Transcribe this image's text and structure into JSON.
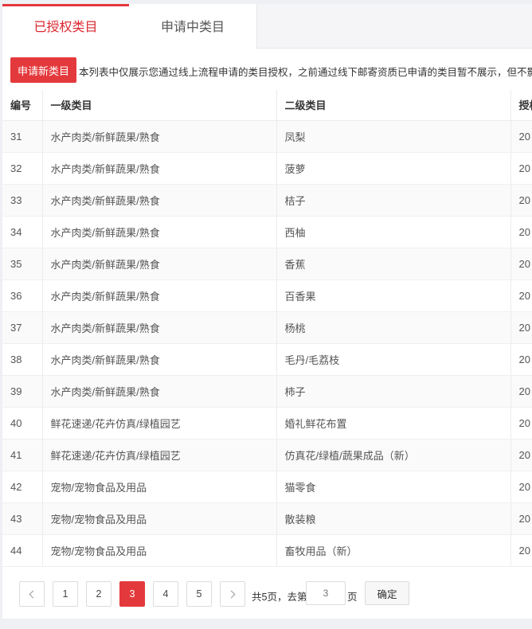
{
  "tabs": [
    {
      "label": "已授权类目",
      "active": true
    },
    {
      "label": "申请中类目",
      "active": false
    }
  ],
  "notice": {
    "button_label": "申请新类目",
    "text": "本列表中仅展示您通过线上流程申请的类目授权，之前通过线下邮寄资质已申请的类目暂不展示，但不影响您"
  },
  "table": {
    "headers": [
      "编号",
      "一级类目",
      "二级类目",
      "授权"
    ],
    "rows": [
      {
        "id": "31",
        "level1": "水产肉类/新鲜蔬果/熟食",
        "level2": "凤梨",
        "auth": "20"
      },
      {
        "id": "32",
        "level1": "水产肉类/新鲜蔬果/熟食",
        "level2": "菠萝",
        "auth": "20"
      },
      {
        "id": "33",
        "level1": "水产肉类/新鲜蔬果/熟食",
        "level2": "桔子",
        "auth": "20"
      },
      {
        "id": "34",
        "level1": "水产肉类/新鲜蔬果/熟食",
        "level2": "西柚",
        "auth": "20"
      },
      {
        "id": "35",
        "level1": "水产肉类/新鲜蔬果/熟食",
        "level2": "香蕉",
        "auth": "20"
      },
      {
        "id": "36",
        "level1": "水产肉类/新鲜蔬果/熟食",
        "level2": "百香果",
        "auth": "20"
      },
      {
        "id": "37",
        "level1": "水产肉类/新鲜蔬果/熟食",
        "level2": "杨桃",
        "auth": "20"
      },
      {
        "id": "38",
        "level1": "水产肉类/新鲜蔬果/熟食",
        "level2": "毛丹/毛荔枝",
        "auth": "20"
      },
      {
        "id": "39",
        "level1": "水产肉类/新鲜蔬果/熟食",
        "level2": "柿子",
        "auth": "20"
      },
      {
        "id": "40",
        "level1": "鲜花速递/花卉仿真/绿植园艺",
        "level2": "婚礼鲜花布置",
        "auth": "20"
      },
      {
        "id": "41",
        "level1": "鲜花速递/花卉仿真/绿植园艺",
        "level2": "仿真花/绿植/蔬果成品（新）",
        "auth": "20"
      },
      {
        "id": "42",
        "level1": "宠物/宠物食品及用品",
        "level2": "猫零食",
        "auth": "20"
      },
      {
        "id": "43",
        "level1": "宠物/宠物食品及用品",
        "level2": "散装粮",
        "auth": "20"
      },
      {
        "id": "44",
        "level1": "宠物/宠物食品及用品",
        "level2": "畜牧用品（新）",
        "auth": "20"
      }
    ]
  },
  "pager": {
    "pages": [
      "1",
      "2",
      "3",
      "4",
      "5"
    ],
    "current_page": "3",
    "total_text": "共5页，去第",
    "page_suffix": "页",
    "goto_placeholder": "3",
    "confirm_label": "确定",
    "prev_icon": "chevron-left-icon",
    "next_icon": "chevron-right-icon"
  },
  "colors": {
    "accent": "#e4393c",
    "active_tab_text": "#d9282f"
  }
}
